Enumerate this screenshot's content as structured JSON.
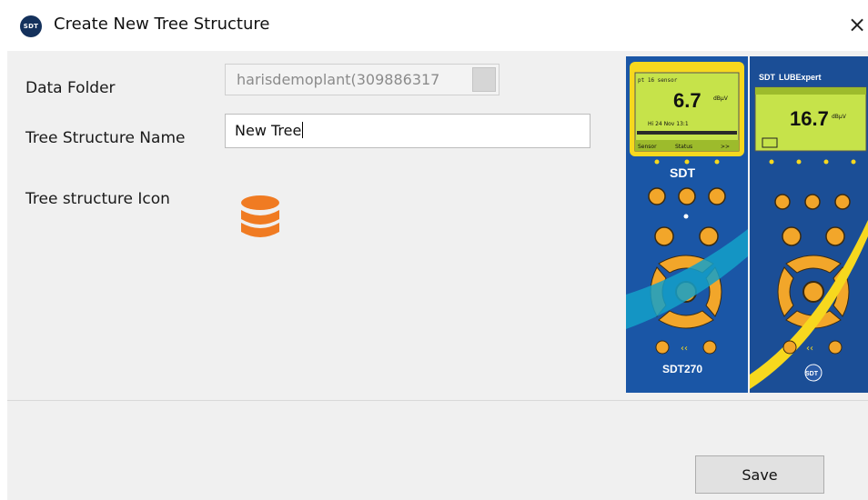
{
  "window": {
    "title": "Create New Tree Structure",
    "logo_text": "SDT",
    "close_glyph": "×"
  },
  "form": {
    "data_folder": {
      "label": "Data Folder",
      "value": "harisdemoplant(309886317"
    },
    "tree_name": {
      "label": "Tree Structure Name",
      "value": "New Tree"
    },
    "tree_icon": {
      "label": "Tree structure Icon",
      "icon": "database-stack-icon",
      "color": "#f07b22"
    }
  },
  "device_image": {
    "left_device": {
      "screen_header": "pt 16 sensor",
      "screen_value": "6.7",
      "screen_unit": "dBµV",
      "screen_sub": "Hi  24 Nov 13:1",
      "screen_footer_left": "Sensor",
      "screen_footer_mid": "Status",
      "screen_footer_right": ">>",
      "brand": "SDT",
      "model": "SDT270"
    },
    "right_device": {
      "brand_prefix": "SDT",
      "brand_main": "LUBExpert",
      "screen_value": "16.7",
      "screen_unit": "dBµV",
      "footer_logo": "SDT"
    },
    "colors": {
      "left_body": "#1a56a6",
      "right_body": "#1b4e96",
      "screen": "#c6e34a",
      "buttons": "#f2a62a",
      "accent_yellow": "#f7d81e"
    }
  },
  "actions": {
    "save_label": "Save"
  }
}
